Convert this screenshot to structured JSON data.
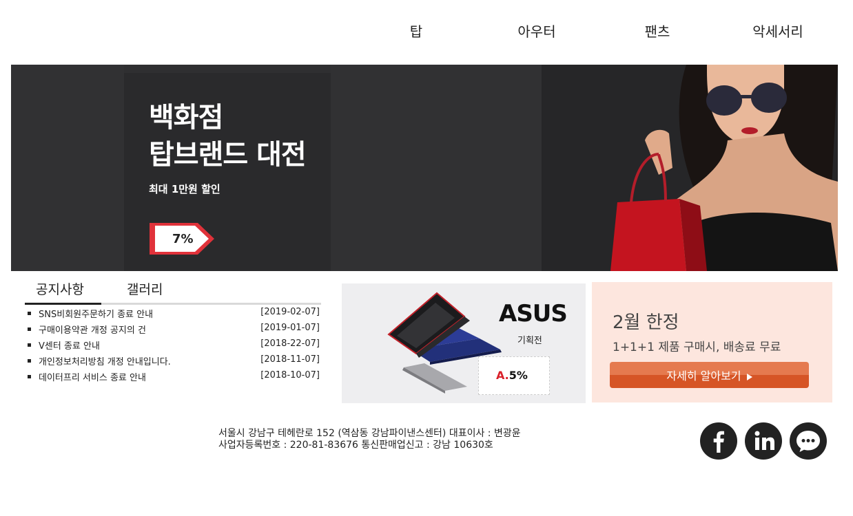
{
  "nav": {
    "items": [
      {
        "label": "탑"
      },
      {
        "label": "아우터"
      },
      {
        "label": "팬츠"
      },
      {
        "label": "악세서리"
      }
    ]
  },
  "hero": {
    "title_line1": "백화점",
    "title_line2": "탑브랜드 대전",
    "subtitle": "최대 1만원 할인",
    "badge": "7%",
    "colors": {
      "background": "#2f2f31",
      "badge_red": "#e0323a"
    }
  },
  "notice": {
    "tabs": [
      {
        "label": "공지사항"
      },
      {
        "label": "갤러리"
      }
    ],
    "items": [
      {
        "title": "SNS비회원주문하기 종료 안내",
        "date": "[2019-02-07]"
      },
      {
        "title": "구매이용약관 개정 공지의 건",
        "date": "[2019-01-07]"
      },
      {
        "title": "V센터 종료 안내",
        "date": "[2018-22-07]"
      },
      {
        "title": "개인정보처리방침 개정 안내입니다.",
        "date": "[2018-11-07]"
      },
      {
        "title": "데이터프리 서비스 종료 안내",
        "date": "[2018-10-07]"
      }
    ]
  },
  "asus_banner": {
    "brand": "ASUS",
    "subtitle": "기획전",
    "tag_prefix": "A.",
    "tag_value": "5%"
  },
  "promo": {
    "title": "2월 한정",
    "subtitle": "1+1+1 제품 구매시, 배송료 무료",
    "button_label": "자세히 알아보기",
    "colors": {
      "background": "#fde6de",
      "button": "#d65526"
    }
  },
  "footer": {
    "line1": "서울시 강남구 테헤란로 152 (역삼동 강남파이낸스센터) 대표이사 : 변광윤",
    "line2": "사업자등록번호 : 220-81-83676 통신판매업신고 : 강남 10630호"
  },
  "social": {
    "icons": [
      "facebook-icon",
      "linkedin-icon",
      "chat-icon"
    ]
  }
}
